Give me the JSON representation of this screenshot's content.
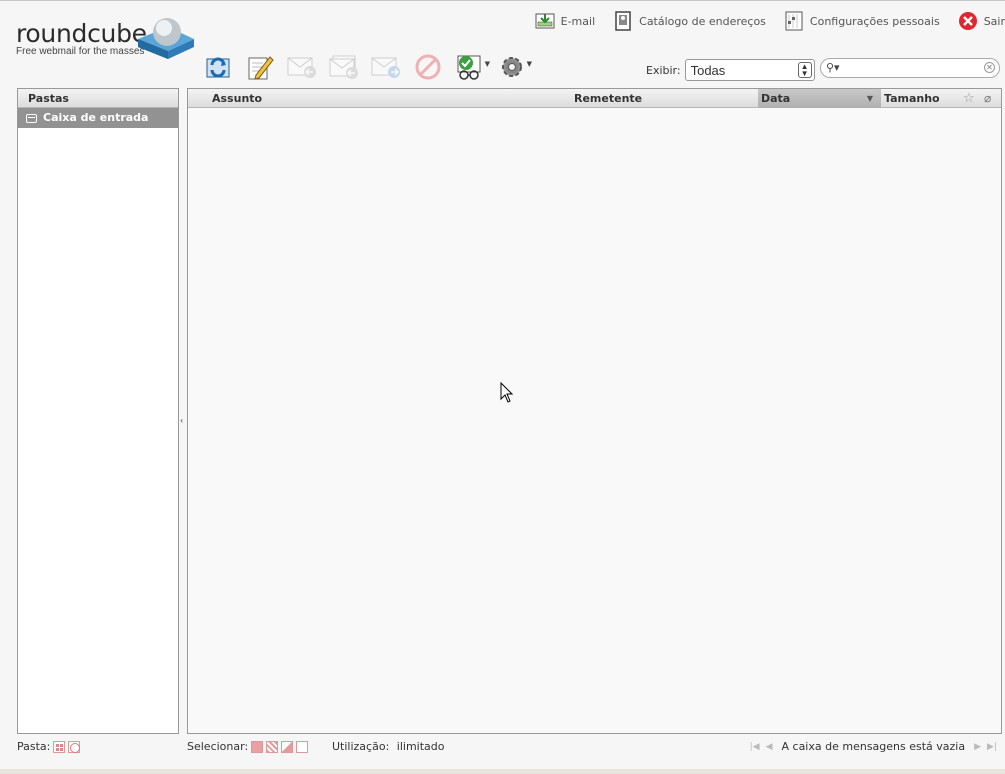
{
  "brand": {
    "name": "roundcube",
    "tagline": "Free webmail for the masses"
  },
  "topnav": [
    {
      "label": "E-mail",
      "icon": "mail-download-icon"
    },
    {
      "label": "Catálogo de endereços",
      "icon": "address-book-icon"
    },
    {
      "label": "Configurações pessoais",
      "icon": "settings-document-icon"
    },
    {
      "label": "Sair",
      "icon": "logout-icon"
    }
  ],
  "toolbar": {
    "buttons": [
      {
        "name": "check-mail",
        "icon": "refresh-mail-icon",
        "enabled": true
      },
      {
        "name": "compose",
        "icon": "compose-pencil-icon",
        "enabled": true
      },
      {
        "name": "reply",
        "icon": "reply-icon",
        "enabled": false
      },
      {
        "name": "reply-all",
        "icon": "reply-all-icon",
        "enabled": false
      },
      {
        "name": "forward",
        "icon": "forward-icon",
        "enabled": false
      },
      {
        "name": "delete",
        "icon": "delete-icon",
        "enabled": false
      },
      {
        "name": "mark",
        "icon": "mark-read-icon",
        "enabled": true
      },
      {
        "name": "more",
        "icon": "gear-icon",
        "enabled": true
      }
    ]
  },
  "filter": {
    "label": "Exibir:",
    "selected": "Todas"
  },
  "search": {
    "placeholder": ""
  },
  "folders": {
    "header": "Pastas",
    "items": [
      {
        "label": "Caixa de entrada",
        "selected": true
      }
    ]
  },
  "messagelist": {
    "columns": {
      "subject": "Assunto",
      "from": "Remetente",
      "date": "Data",
      "size": "Tamanho"
    },
    "rows": []
  },
  "footer": {
    "folder_label": "Pasta:",
    "select_label": "Selecionar:",
    "quota_label": "Utilização:",
    "quota_value": "ilimitado",
    "status": "A caixa de mensagens está vazia"
  },
  "colors": {
    "accent": "#929292",
    "selected_column": "#b8b8b8",
    "logout_red": "#e0262e"
  }
}
